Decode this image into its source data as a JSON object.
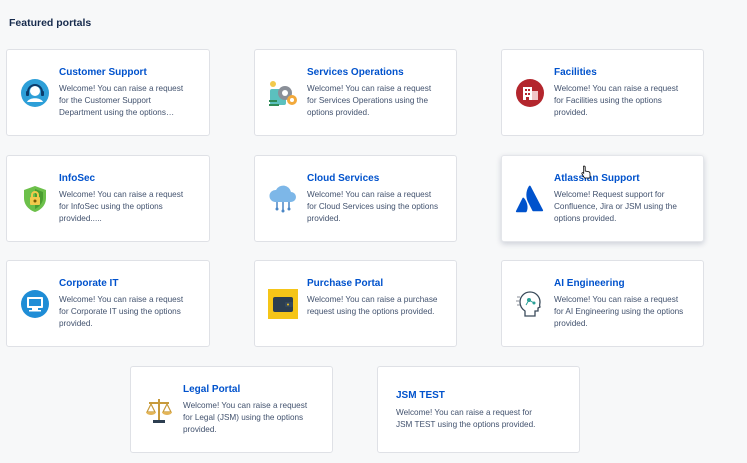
{
  "heading": "Featured portals",
  "portals": [
    {
      "title": "Customer Support",
      "desc": "Welcome! You can raise a request for the Customer Support Department using the options…",
      "icon": "headset-icon"
    },
    {
      "title": "Services Operations",
      "desc": "Welcome! You can raise a request for Services Operations using the options provided.",
      "icon": "gears-icon"
    },
    {
      "title": "Facilities",
      "desc": "Welcome! You can raise a request for Facilities using the options provided.",
      "icon": "building-icon"
    },
    {
      "title": "InfoSec",
      "desc": "Welcome! You can raise a request for InfoSec using the options provided.....",
      "icon": "shield-lock-icon"
    },
    {
      "title": "Cloud Services",
      "desc": "Welcome! You can raise a request for Cloud Services using the options provided.",
      "icon": "cloud-icon"
    },
    {
      "title": "Atlassian Support",
      "desc": "Welcome! Request support for Confluence, Jira or JSM using the options provided.",
      "icon": "atlassian-logo-icon"
    },
    {
      "title": "Corporate IT",
      "desc": "Welcome! You can raise a request for Corporate IT using the options provided.",
      "icon": "computer-icon"
    },
    {
      "title": "Purchase Portal",
      "desc": "Welcome! You can raise a purchase request using the options provided.",
      "icon": "wallet-icon"
    },
    {
      "title": "AI Engineering",
      "desc": "Welcome! You can raise a request for AI Engineering using the options provided.",
      "icon": "ai-head-icon"
    },
    {
      "title": "Legal Portal",
      "desc": "Welcome! You can raise a request for Legal (JSM) using the options provided.",
      "icon": "scales-icon"
    },
    {
      "title": "JSM TEST",
      "desc": "Welcome! You can raise a request for JSM TEST using the options provided.",
      "icon": ""
    }
  ]
}
